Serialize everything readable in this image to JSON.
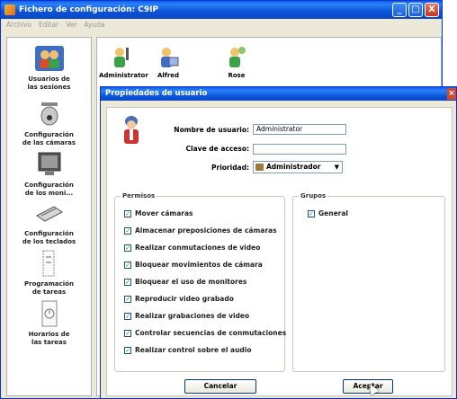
{
  "window": {
    "title": "Fichero de configuración: C9IP",
    "controls": [
      "_",
      "□",
      "X"
    ]
  },
  "menubar": [
    "Archivo",
    "Editar",
    "Ver",
    "Ayuda"
  ],
  "sidebar": {
    "items": [
      {
        "label": "Usuarios de\nlas sesiones",
        "icon": "users-icon"
      },
      {
        "label": "Configuración\nde las cámaras",
        "icon": "camera-icon"
      },
      {
        "label": "Configuración\nde los moni...",
        "icon": "monitor-icon"
      },
      {
        "label": "Configuración\nde los teclados",
        "icon": "keyboard-icon"
      },
      {
        "label": "Programación\nde tareas",
        "icon": "task-icon"
      },
      {
        "label": "Horarios de\nlas tareas",
        "icon": "schedule-icon"
      }
    ]
  },
  "users": [
    {
      "label": "Administrator"
    },
    {
      "label": "Alfred"
    },
    {
      "label": "Rose"
    }
  ],
  "dialog": {
    "title": "Propiedades de usuario",
    "fields": {
      "username_label": "Nombre de usuario:",
      "username_value": "Administrator",
      "password_label": "Clave de acceso:",
      "password_value": "",
      "priority_label": "Prioridad:",
      "priority_value": "Administrador"
    },
    "permissions": {
      "legend": "Permisos",
      "items": [
        {
          "label": "Mover cámaras",
          "checked": true
        },
        {
          "label": "Almacenar preposiciones de cámaras",
          "checked": true
        },
        {
          "label": "Realizar conmutaciones de video",
          "checked": true
        },
        {
          "label": "Bloquear movimientos de cámara",
          "checked": true
        },
        {
          "label": "Bloquear el uso de monitores",
          "checked": true
        },
        {
          "label": "Reproducir video grabado",
          "checked": true
        },
        {
          "label": "Realizar grabaciones de video",
          "checked": true
        },
        {
          "label": "Controlar secuencias de conmutaciones",
          "checked": true
        },
        {
          "label": "Realizar control sobre el audio",
          "checked": true
        }
      ]
    },
    "groups": {
      "legend": "Grupos",
      "items": [
        {
          "label": "General",
          "checked": true
        }
      ]
    },
    "cancel_label": "Cancelar",
    "accept_label": "Aceptar"
  },
  "colors": {
    "titlebar": "#0b52d6",
    "window_bg": "#ece9d8",
    "check": "#21a121"
  }
}
